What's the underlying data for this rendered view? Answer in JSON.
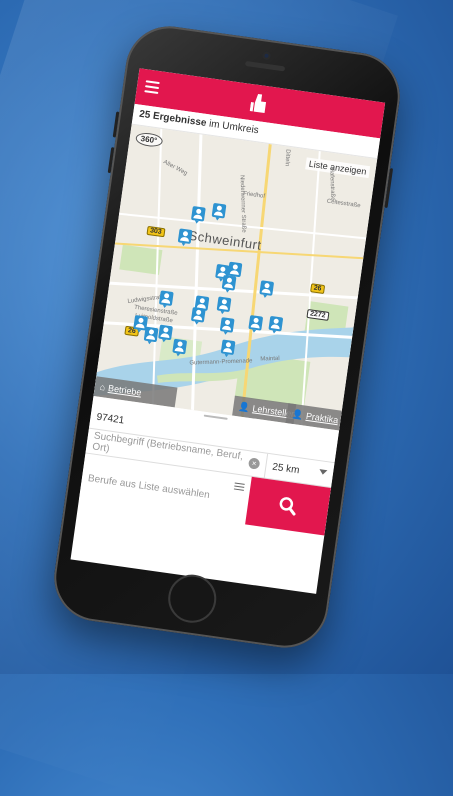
{
  "header": {
    "menu_icon": "hamburger-icon",
    "logo_icon": "thumbs-up-logo-icon",
    "brand_color": "#e2174e"
  },
  "results": {
    "count_text": "25 Ergebnisse",
    "suffix_text": " im Umkreis",
    "list_button_label": "Liste anzeigen",
    "badge_360": "360°"
  },
  "map": {
    "city_name": "Schweinfurt",
    "road_signs": [
      "303",
      "26",
      "2272",
      "26"
    ],
    "streets": [
      "Alter Weg",
      "Niederwerrner Straße",
      "Friedhof",
      "Ditteln",
      "Ludwigsstraße",
      "Luitpoldstraße",
      "Gutermann-Promenade",
      "Maintal",
      "Celtesstraße",
      "Hafenstraße",
      "Theresienstraße"
    ],
    "marker_color": "#2e93d1",
    "tabs": {
      "betriebe": "Betriebe",
      "lehrstellen": "Lehrstellen",
      "praktika": "Praktika"
    }
  },
  "search": {
    "location_value": "97421",
    "query_placeholder": "Suchbegriff (Betriebsname, Beruf, Ort)",
    "radius_value": "25 km",
    "profession_placeholder": "Berufe aus Liste auswählen",
    "search_icon": "magnifier-icon"
  }
}
